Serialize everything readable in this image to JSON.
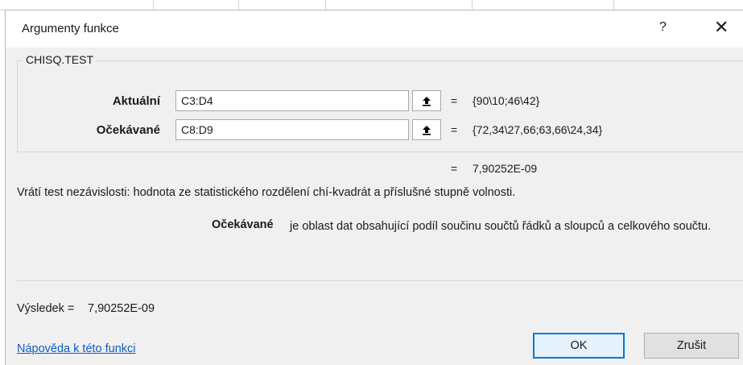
{
  "dialog": {
    "title": "Argumenty funkce",
    "help_label": "?",
    "close_label": "✕"
  },
  "function": {
    "name": "CHISQ.TEST",
    "args": [
      {
        "label": "Aktuální",
        "value": "C3:D4",
        "evaluated": "{90\\10;46\\42}"
      },
      {
        "label": "Očekávané",
        "value": "C8:D9",
        "evaluated": "{72,34\\27,66;63,66\\24,34}"
      }
    ],
    "equals": "=",
    "formula_result": "7,90252E-09",
    "description": "Vrátí test nezávislosti: hodnota ze statistického rozdělení chí-kvadrát a příslušné stupně volnosti.",
    "arg_desc_name": "Očekávané",
    "arg_desc_text": "je oblast dat obsahující podíl součinu součtů řádků a sloupců a celkového součtu."
  },
  "result": {
    "label": "Výsledek =",
    "value": "7,90252E-09"
  },
  "footer": {
    "help_link": "Nápověda k této funkci",
    "ok_label": "OK",
    "cancel_label": "Zrušit"
  }
}
